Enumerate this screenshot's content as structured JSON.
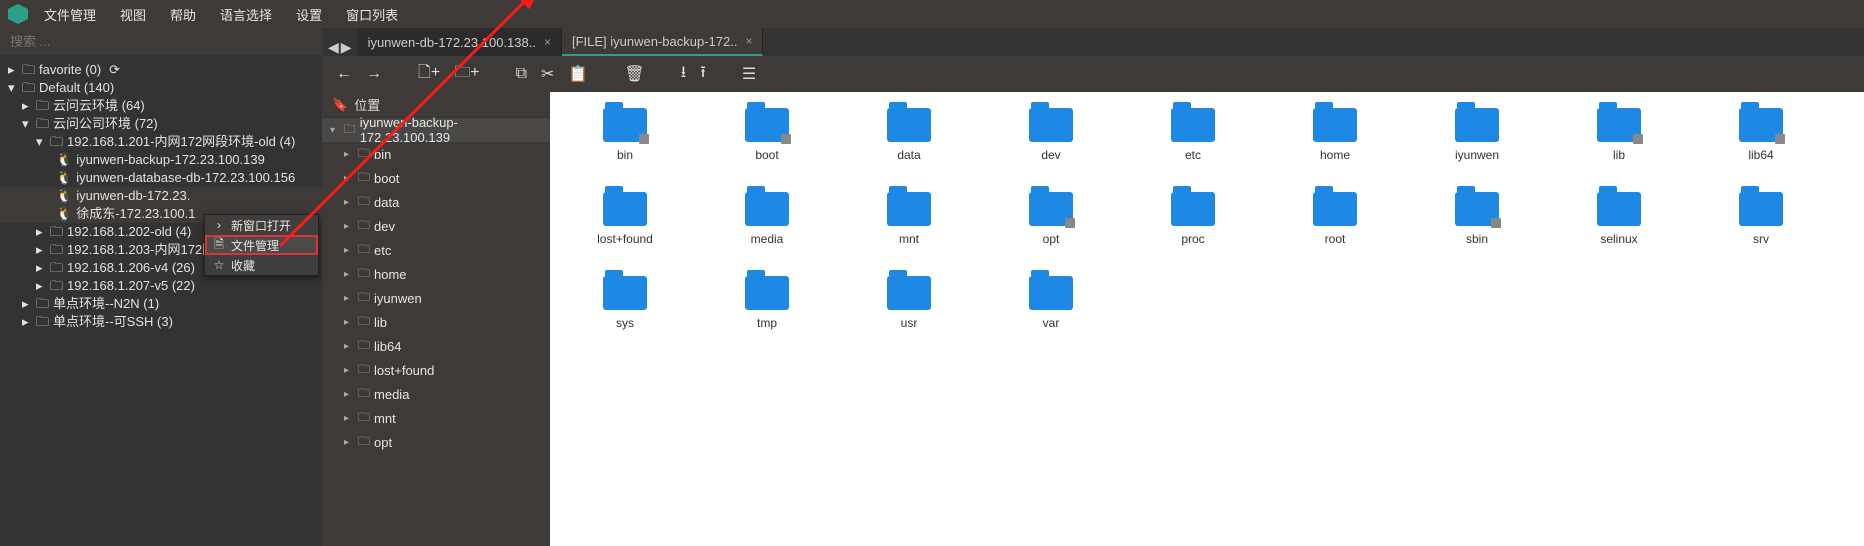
{
  "menu": [
    "文件管理",
    "视图",
    "帮助",
    "语言选择",
    "设置",
    "窗口列表"
  ],
  "search": {
    "placeholder": "搜索 ..."
  },
  "tree": {
    "favorite": "favorite (0)",
    "default": "Default (140)",
    "n1": "云问云环境 (64)",
    "n2": "云问公司环境 (72)",
    "n3": "192.168.1.201-内网172网段环境-old (4)",
    "n3a": "iyunwen-backup-172.23.100.139",
    "n3b": "iyunwen-database-db-172.23.100.156",
    "n3c": "iyunwen-db-172.23.",
    "n3d": "徐成东-172.23.100.1",
    "n4": "192.168.1.202-old (4)",
    "n5": "192.168.1.203-内网172网段环境 (10)",
    "n6": "192.168.1.206-v4 (26)",
    "n7": "192.168.1.207-v5 (22)",
    "n8": "单点环境--N2N (1)",
    "n9": "单点环境--可SSH (3)"
  },
  "context": {
    "i1": "新窗口打开",
    "i2": "文件管理",
    "i3": "收藏"
  },
  "tabs": {
    "t1": "iyunwen-db-172.23.100.138..",
    "t2": "[FILE] iyunwen-backup-172.."
  },
  "mid": {
    "head": "位置",
    "root": "iyunwen-backup-172.23.100.139",
    "items": [
      "bin",
      "boot",
      "data",
      "dev",
      "etc",
      "home",
      "iyunwen",
      "lib",
      "lib64",
      "lost+found",
      "media",
      "mnt",
      "opt"
    ]
  },
  "files": [
    {
      "n": "bin",
      "lock": true
    },
    {
      "n": "boot",
      "lock": true
    },
    {
      "n": "data"
    },
    {
      "n": "dev"
    },
    {
      "n": "etc"
    },
    {
      "n": "home"
    },
    {
      "n": "iyunwen"
    },
    {
      "n": "lib",
      "lock": true
    },
    {
      "n": "lib64",
      "lock": true
    },
    {
      "n": "lost+found"
    },
    {
      "n": "media"
    },
    {
      "n": "mnt"
    },
    {
      "n": "opt",
      "lock": true
    },
    {
      "n": "proc"
    },
    {
      "n": "root"
    },
    {
      "n": "sbin",
      "lock": true
    },
    {
      "n": "selinux"
    },
    {
      "n": "srv"
    },
    {
      "n": "sys"
    },
    {
      "n": "tmp"
    },
    {
      "n": "usr"
    },
    {
      "n": "var"
    }
  ]
}
